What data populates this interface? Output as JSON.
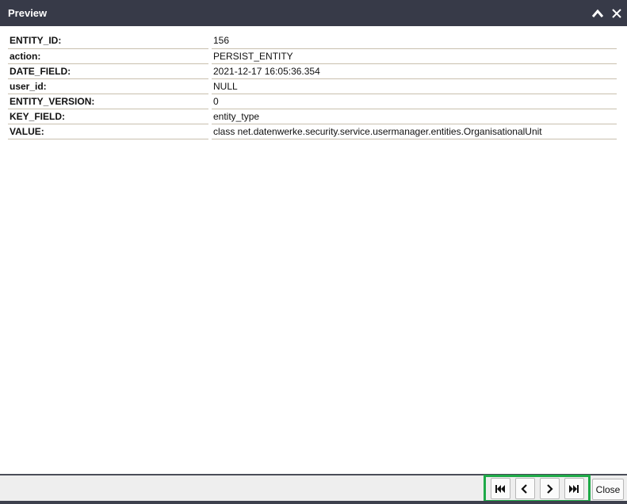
{
  "window": {
    "title": "Preview",
    "collapse_icon": "chevron-up-icon",
    "close_icon": "close-icon"
  },
  "properties": [
    {
      "key": "ENTITY_ID:",
      "value": "156"
    },
    {
      "key": "action:",
      "value": "PERSIST_ENTITY"
    },
    {
      "key": "DATE_FIELD:",
      "value": "2021-12-17 16:05:36.354"
    },
    {
      "key": "user_id:",
      "value": "NULL"
    },
    {
      "key": "ENTITY_VERSION:",
      "value": "0"
    },
    {
      "key": "KEY_FIELD:",
      "value": "entity_type"
    },
    {
      "key": "VALUE:",
      "value": "class net.datenwerke.security.service.usermanager.entities.OrganisationalUnit"
    }
  ],
  "footer": {
    "nav": {
      "first_icon": "skip-first-icon",
      "prev_icon": "chevron-left-icon",
      "next_icon": "chevron-right-icon",
      "last_icon": "skip-last-icon",
      "highlight_color": "#1eaa48"
    },
    "close_label": "Close"
  }
}
